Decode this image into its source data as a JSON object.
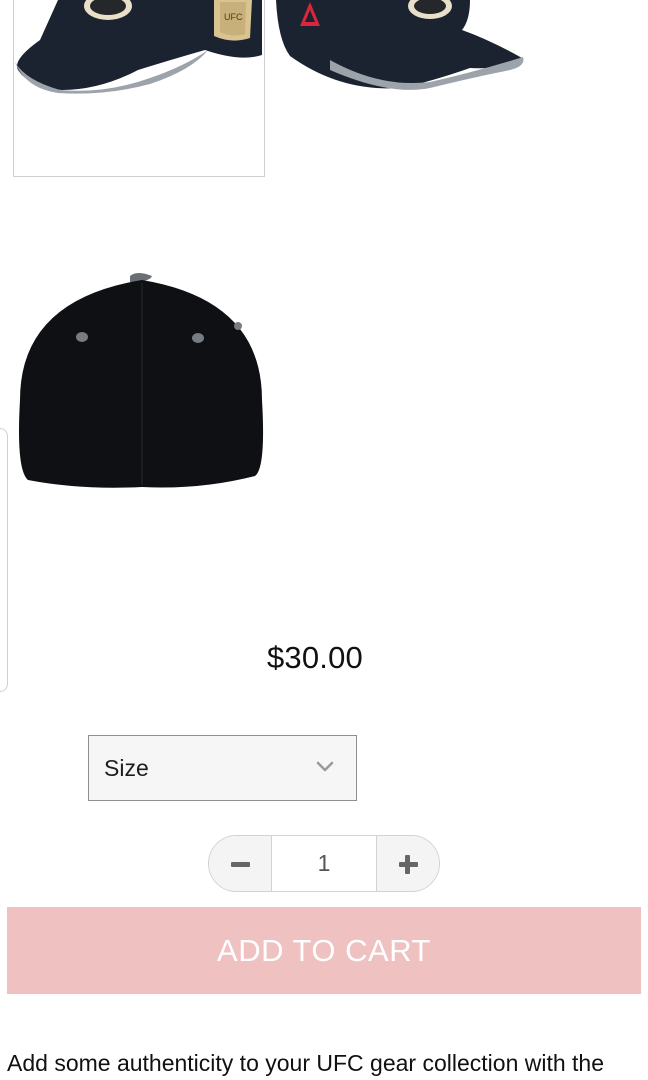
{
  "product": {
    "thumbnails": [
      {
        "name": "cap-side-left",
        "brand_mark": ""
      },
      {
        "name": "cap-side-right",
        "brand_mark": "Reebok"
      },
      {
        "name": "cap-back",
        "brand_mark": ""
      }
    ],
    "price": "$30.00",
    "size_select": {
      "label": "Size"
    },
    "quantity": {
      "value": "1"
    },
    "add_to_cart_label": "ADD TO CART",
    "description": "Add some authenticity to your UFC gear collection with the"
  },
  "colors": {
    "add_to_cart_bg": "#f0c1c1",
    "reebok_red": "#d7263d",
    "cap_navy": "#1c2330"
  }
}
